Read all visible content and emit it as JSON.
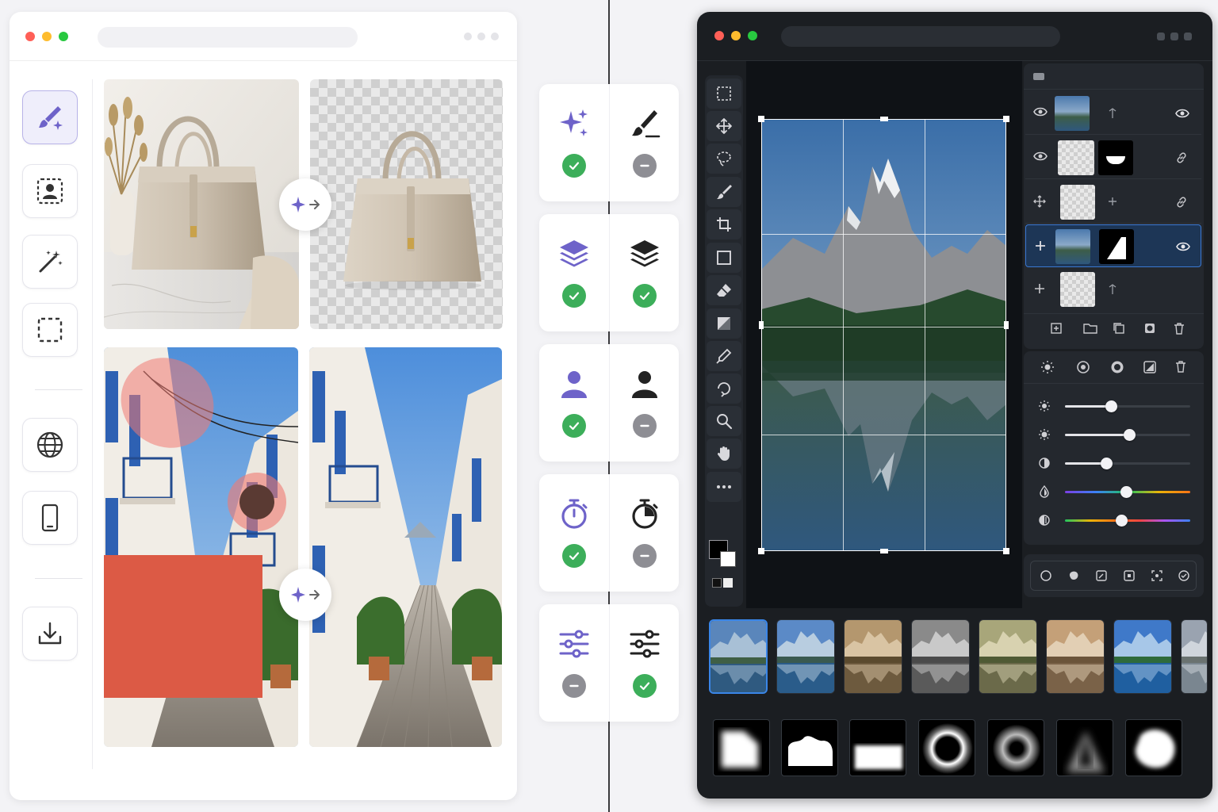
{
  "left_window": {
    "side_tools": [
      {
        "name": "brush-sparkle-tool",
        "icon": "paintbrush-sparkle-icon",
        "active": true
      },
      {
        "name": "portrait-select-tool",
        "icon": "person-select-icon"
      },
      {
        "name": "magic-wand-tool",
        "icon": "magic-wand-icon"
      },
      {
        "name": "marquee-select-tool",
        "icon": "dashed-square-icon"
      },
      {
        "name": "web-tool",
        "icon": "globe-icon"
      },
      {
        "name": "mobile-tool",
        "icon": "phone-icon"
      },
      {
        "name": "download-tool",
        "icon": "download-icon"
      }
    ],
    "examples": [
      {
        "name": "background-removal",
        "before": "handbag-on-marble",
        "after": "handbag-transparent"
      },
      {
        "name": "object-removal",
        "before": "street-with-marked-objects",
        "after": "clean-street"
      }
    ]
  },
  "feature_cards": [
    {
      "icon_left": "sparkles-icon",
      "icon_right": "brush-icon",
      "left": "ok",
      "right": "no"
    },
    {
      "icon_left": "layers-icon",
      "icon_right": "layers-icon",
      "left": "ok",
      "right": "ok"
    },
    {
      "icon_left": "person-icon",
      "icon_right": "person-icon",
      "left": "ok",
      "right": "no"
    },
    {
      "icon_left": "stopwatch-icon",
      "icon_right": "stopwatch-icon",
      "left": "ok",
      "right": "no"
    },
    {
      "icon_left": "sliders-icon",
      "icon_right": "sliders-icon",
      "left": "no",
      "right": "ok"
    }
  ],
  "colors": {
    "accent": "#6e63c9",
    "ok": "#3cae5a",
    "no": "#8e8e94",
    "dark_bg": "#1b1e22",
    "selection_blue": "#3a78d2"
  },
  "right_window": {
    "tools": [
      "marquee-icon",
      "move-icon",
      "lasso-icon",
      "brush-icon",
      "crop-icon",
      "rectangle-icon",
      "eraser-icon",
      "gradient-icon",
      "eyedropper-icon",
      "rotate-icon",
      "zoom-icon",
      "hand-icon",
      "more-icon"
    ],
    "layers": [
      {
        "name": "layer-mountain",
        "visible": true
      },
      {
        "name": "layer-mask",
        "visible": true
      },
      {
        "name": "layer-empty-1",
        "visible": false
      },
      {
        "name": "layer-mountain-masked",
        "visible": true,
        "selected": true
      },
      {
        "name": "layer-empty-2",
        "visible": false
      }
    ],
    "adjustments": [
      {
        "name": "brightness",
        "value": 0.37
      },
      {
        "name": "exposure",
        "value": 0.51
      },
      {
        "name": "contrast",
        "value": 0.33
      },
      {
        "name": "hue",
        "value": 0.49
      },
      {
        "name": "saturation",
        "value": 0.45
      }
    ],
    "filters": [
      "original",
      "cool",
      "warm",
      "mono",
      "vintage",
      "sepia",
      "vivid",
      "fade"
    ],
    "brushes": [
      "soft-square",
      "hard-cloud",
      "soft-rect",
      "ring",
      "soft-ring",
      "spike",
      "soft-blob"
    ]
  }
}
